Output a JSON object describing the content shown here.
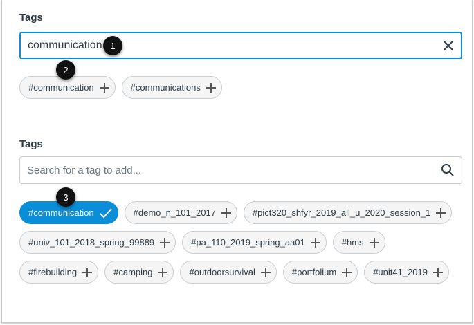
{
  "section1": {
    "label": "Tags",
    "input_value": "communication",
    "suggestions": [
      "#communication",
      "#communications"
    ]
  },
  "section2": {
    "label": "Tags",
    "placeholder": "Search for a tag to add...",
    "tags": [
      {
        "label": "#communication",
        "selected": true
      },
      {
        "label": "#demo_n_101_2017",
        "selected": false
      },
      {
        "label": "#pict320_shfyr_2019_all_u_2020_session_1",
        "selected": false
      },
      {
        "label": "#univ_101_2018_spring_99889",
        "selected": false
      },
      {
        "label": "#pa_110_2019_spring_aa01",
        "selected": false
      },
      {
        "label": "#hms",
        "selected": false
      },
      {
        "label": "#firebuilding",
        "selected": false
      },
      {
        "label": "#camping",
        "selected": false
      },
      {
        "label": "#outdoorsurvival",
        "selected": false
      },
      {
        "label": "#portfolium",
        "selected": false
      },
      {
        "label": "#unit41_2019",
        "selected": false
      }
    ]
  },
  "badges": [
    "1",
    "2",
    "3"
  ],
  "colors": {
    "accent": "#0a8ed8"
  }
}
